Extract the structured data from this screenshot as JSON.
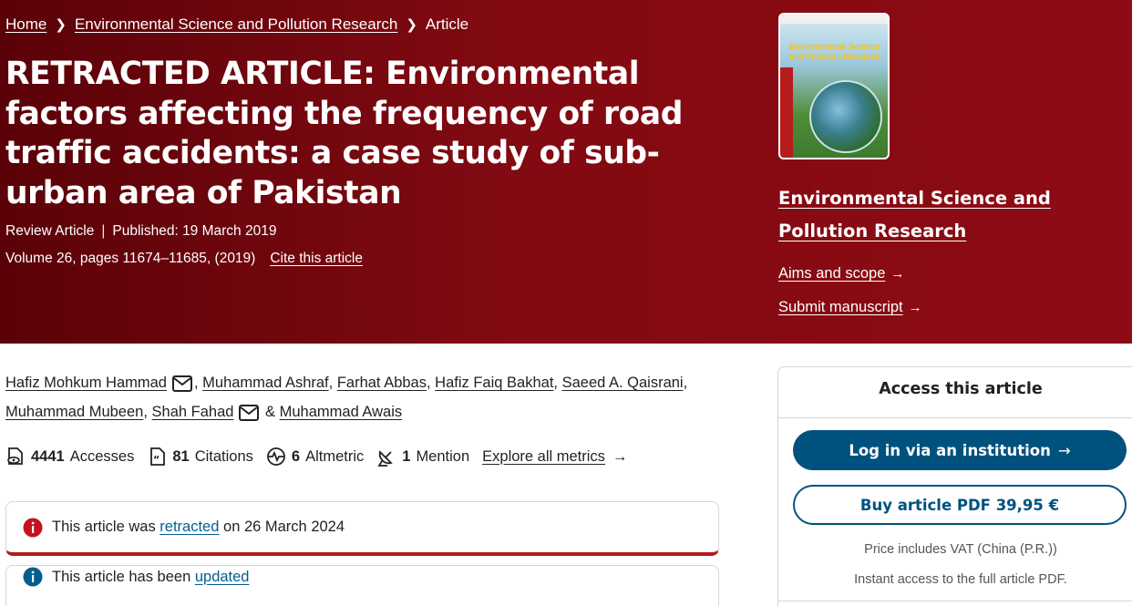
{
  "breadcrumb": {
    "home": "Home",
    "journal": "Environmental Science and Pollution Research",
    "current": "Article"
  },
  "article": {
    "title": "RETRACTED ARTICLE: Environmental factors affecting the frequency of road traffic accidents: a case study of sub-urban area of Pakistan",
    "type": "Review Article",
    "published": "Published: 19 March 2019",
    "volume": "Volume 26, pages 11674–11685, (2019)",
    "cite": "Cite this article"
  },
  "journal": {
    "cover_title": "Environmental Science and Pollution Research",
    "title": "Environmental Science and Pollution Research",
    "aims": "Aims and scope",
    "submit": "Submit manuscript"
  },
  "authors": [
    "Hafiz Mohkum Hammad",
    "Muhammad Ashraf",
    "Farhat Abbas",
    "Hafiz Faiq Bakhat",
    "Saeed A. Qaisrani",
    "Muhammad Mubeen",
    "Shah Fahad",
    "Muhammad Awais"
  ],
  "author_separators": {
    "comma": ",",
    "amp": "&"
  },
  "metrics": {
    "accesses_count": "4441",
    "accesses_label": "Accesses",
    "citations_count": "81",
    "citations_label": "Citations",
    "altmetric_count": "6",
    "altmetric_label": "Altmetric",
    "mention_count": "1",
    "mention_label": "Mention",
    "explore": "Explore all metrics"
  },
  "notices": {
    "retracted_prefix": "This article was",
    "retracted_link": "retracted",
    "retracted_suffix": "on 26 March 2024",
    "updated_prefix": "This article has been",
    "updated_link": "updated"
  },
  "access": {
    "title": "Access this article",
    "login": "Log in via an institution",
    "buy": "Buy article PDF 39,95 €",
    "vat": "Price includes VAT (China (P.R.))",
    "instant": "Instant access to the full article PDF."
  },
  "colors": {
    "hero_dark": "#5a0208",
    "hero": "#8d0b14",
    "link_blue": "#025e8d",
    "button_blue": "#01517f",
    "retracted_red": "#b21c1c"
  }
}
